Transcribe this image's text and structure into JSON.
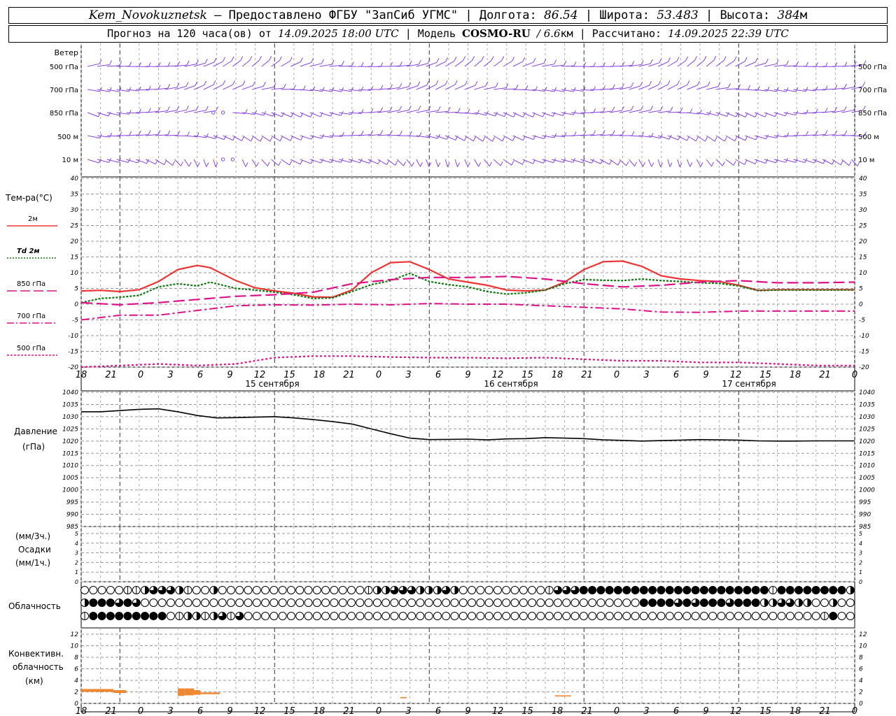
{
  "header": {
    "station": "Kem_Novokuznetsk",
    "provider": "— Предоставлено ФГБУ \"ЗапСиб УГМС\"",
    "lon_label": "| Долгота:",
    "lon": "86.54",
    "lat_label": "| Широта:",
    "lat": "53.483",
    "alt_label": "| Высота:",
    "alt": "384",
    "alt_unit": "м",
    "forecast_label": "Прогноз на 120 часа(ов) от",
    "forecast_start": "14.09.2025 18:00 UTC",
    "model_label": "| Модель",
    "model": "COSMO-RU",
    "resolution": "/ 6.6",
    "resolution_unit": "км",
    "calc_label": "| Рассчитано:",
    "calc_time": "14.09.2025 22:39 UTC"
  },
  "panels": {
    "wind": {
      "title": "Ветер",
      "levels": [
        "500 гПа",
        "700 гПа",
        "850 гПа",
        "500 м",
        "10 м"
      ]
    },
    "temperature": {
      "title": "Тем-ра(°C)",
      "legend": [
        {
          "label": "2м",
          "color": "#ee3333",
          "dash": "solid"
        },
        {
          "label": "Td 2м",
          "color": "#117711",
          "dash": "dotted"
        },
        {
          "label": "850 гПа",
          "color": "#dd1188",
          "dash": "long"
        },
        {
          "label": "700 гПа",
          "color": "#dd1188",
          "dash": "dashdot"
        },
        {
          "label": "500 гПа",
          "color": "#dd1188",
          "dash": "short"
        }
      ]
    },
    "pressure": {
      "title": "Давление",
      "unit": "(гПа)"
    },
    "precip": {
      "unit_top": "(мм/3ч.)",
      "title": "Осадки",
      "unit_bottom": "(мм/1ч.)"
    },
    "cloud": {
      "title": "Облачность"
    },
    "convective": {
      "title_1": "Конвективн.",
      "title_2": "облачность",
      "unit": "(км)"
    }
  },
  "time_axis": {
    "hour_labels": [
      "18",
      "21",
      "0",
      "3",
      "6",
      "9",
      "12",
      "15",
      "18",
      "21",
      "0",
      "3",
      "6",
      "9",
      "12",
      "15",
      "18",
      "21",
      "0",
      "3",
      "6",
      "9",
      "12",
      "15",
      "18",
      "21",
      "0"
    ],
    "day_labels": [
      "15 сентября",
      "16 сентября",
      "17 сентября"
    ],
    "day_label_positions_h": [
      15,
      39,
      63
    ]
  },
  "colors": {
    "temp2m": "#ee3333",
    "dew": "#117711",
    "upper": "#dd1188",
    "wind": "#8844dd",
    "pressure": "#000000",
    "convective": "#ee8833"
  },
  "chart_data": [
    {
      "type": "line",
      "title": "Тем-ра(°C)",
      "x_unit": "hours since 14.09.2025 18:00 UTC",
      "ylim": [
        -20,
        40
      ],
      "y_ticks": [
        -20,
        -15,
        -10,
        -5,
        0,
        5,
        10,
        15,
        20,
        25,
        30,
        35,
        40
      ],
      "series": [
        {
          "name": "2м",
          "x": [
            0,
            3,
            6,
            9,
            12,
            15,
            18,
            20,
            24,
            27,
            30,
            33,
            36,
            39,
            42,
            45,
            48,
            51,
            54,
            57,
            60,
            63,
            66,
            69,
            72,
            75,
            78,
            81,
            84,
            87,
            90,
            93,
            96,
            99,
            102,
            105,
            108,
            111,
            114,
            117,
            120
          ],
          "y": [
            4.2,
            4.4,
            4.0,
            4.6,
            7.2,
            11,
            12.3,
            11.6,
            7.5,
            5.2,
            4.2,
            3.5,
            2.3,
            2.2,
            4.5,
            10,
            13.2,
            13.5,
            11,
            8,
            7,
            6,
            4.5,
            4.2,
            4.5,
            7,
            11,
            13.5,
            13.7,
            12,
            9,
            8,
            7.5,
            7.2,
            6,
            4.4,
            4.6,
            4.6,
            4.6,
            4.6,
            4.6
          ]
        },
        {
          "name": "Td 2м",
          "x": [
            0,
            3,
            6,
            9,
            12,
            15,
            18,
            20,
            24,
            27,
            30,
            33,
            36,
            39,
            42,
            45,
            48,
            51,
            54,
            57,
            60,
            63,
            66,
            69,
            72,
            75,
            78,
            81,
            84,
            87,
            90,
            93,
            96,
            99,
            102,
            105,
            108,
            111,
            114,
            117,
            120
          ],
          "y": [
            0.5,
            1.8,
            2.2,
            2.8,
            5.5,
            6.5,
            5.8,
            7.0,
            5,
            4.5,
            3.8,
            3,
            1.8,
            2,
            4,
            6.2,
            7.5,
            9.8,
            7.2,
            6.2,
            5.5,
            4,
            3.2,
            3.6,
            4.5,
            6.5,
            7.8,
            7.6,
            7.5,
            8,
            7.5,
            7.2,
            6.8,
            6.6,
            5.8,
            4.3,
            4.5,
            4.5,
            4.5,
            4.5,
            4.5
          ]
        },
        {
          "name": "850 гПа",
          "x": [
            0,
            6,
            12,
            18,
            24,
            30,
            36,
            42,
            48,
            54,
            60,
            66,
            72,
            78,
            84,
            90,
            96,
            102,
            108,
            114,
            120
          ],
          "y": [
            0.5,
            -0.2,
            0.5,
            1.5,
            2.5,
            3,
            3.8,
            6.5,
            7.8,
            8.5,
            8.5,
            8.8,
            8,
            6.5,
            5.5,
            6,
            7,
            7.5,
            6.8,
            6.8,
            7
          ]
        },
        {
          "name": "700 гПа",
          "x": [
            0,
            6,
            12,
            18,
            24,
            30,
            36,
            42,
            48,
            54,
            60,
            66,
            72,
            78,
            84,
            90,
            96,
            102,
            108,
            114,
            120
          ],
          "y": [
            -5,
            -3.5,
            -3.5,
            -2,
            -0.5,
            -0.2,
            -0.3,
            0,
            -0.2,
            0.2,
            0,
            0,
            -0.5,
            -1,
            -1.5,
            -2.5,
            -2.6,
            -2.2,
            -2.2,
            -2.2,
            -2.2
          ]
        },
        {
          "name": "500 гПа",
          "x": [
            0,
            6,
            12,
            18,
            24,
            30,
            36,
            42,
            48,
            54,
            60,
            66,
            72,
            78,
            84,
            90,
            96,
            102,
            108,
            114,
            120
          ],
          "y": [
            -20,
            -19.5,
            -19,
            -19.5,
            -19,
            -17,
            -16.5,
            -16.5,
            -16.8,
            -17,
            -17,
            -17.2,
            -17,
            -17.5,
            -18,
            -18,
            -18.5,
            -18.5,
            -19,
            -19.5,
            -19.5
          ]
        }
      ]
    },
    {
      "type": "line",
      "title": "Давление",
      "ylabel": "(гПа)",
      "ylim": [
        985,
        1040
      ],
      "y_ticks": [
        985,
        990,
        995,
        1000,
        1005,
        1010,
        1015,
        1020,
        1025,
        1030,
        1035,
        1040
      ],
      "series": [
        {
          "x": [
            0,
            3,
            6,
            9,
            12,
            15,
            18,
            21,
            24,
            27,
            30,
            33,
            36,
            39,
            42,
            45,
            48,
            51,
            54,
            57,
            60,
            63,
            66,
            69,
            72,
            75,
            78,
            81,
            84,
            87,
            90,
            93,
            96,
            99,
            102,
            105,
            108,
            111,
            114,
            117,
            120
          ],
          "y": [
            1032,
            1032,
            1032.5,
            1033,
            1033.2,
            1032,
            1030.5,
            1029.5,
            1029.6,
            1029.8,
            1030,
            1029.5,
            1028.8,
            1028,
            1027,
            1025,
            1023,
            1021.2,
            1020.6,
            1020.7,
            1020.8,
            1020.5,
            1020.9,
            1021,
            1021.4,
            1021.2,
            1021,
            1020.5,
            1020.3,
            1020,
            1020.2,
            1020.4,
            1020.6,
            1020.5,
            1020.4,
            1020.1,
            1020,
            1020,
            1020.1,
            1020.1,
            1020.1
          ]
        }
      ]
    },
    {
      "type": "bar",
      "title": "Осадки",
      "ylabel": "(мм/1ч.)",
      "ylim": [
        0,
        5
      ],
      "y_ticks": [
        0,
        1,
        2,
        3,
        4,
        5
      ],
      "values": []
    },
    {
      "type": "bar",
      "title": "Конвективн. облачность",
      "ylabel": "(км)",
      "ylim": [
        0,
        13
      ],
      "y_ticks": [
        0,
        2,
        4,
        6,
        8,
        10,
        12
      ],
      "segments": [
        {
          "x0": 0,
          "x1": 5,
          "bottom": 2.0,
          "top": 2.5
        },
        {
          "x0": 5,
          "x1": 7,
          "bottom": 1.8,
          "top": 2.3
        },
        {
          "x0": 12,
          "x1": 14,
          "bottom": 0,
          "top": 0
        },
        {
          "x0": 15,
          "x1": 16,
          "bottom": 1.3,
          "top": 2.6
        },
        {
          "x0": 16,
          "x1": 17.5,
          "bottom": 1.4,
          "top": 2.6
        },
        {
          "x0": 17.5,
          "x1": 18.5,
          "bottom": 1.5,
          "top": 2.3
        },
        {
          "x0": 18.5,
          "x1": 21.5,
          "bottom": 1.6,
          "top": 1.9
        },
        {
          "x0": 49.5,
          "x1": 50.5,
          "bottom": 0.9,
          "top": 1.1
        },
        {
          "x0": 73.5,
          "x1": 76,
          "bottom": 1.2,
          "top": 1.4
        }
      ]
    }
  ],
  "cloud_rows": [
    "0000011233321002000000000000000001223332223200000000001333444444444444444444444414444444420",
    "2444343000000000000000000000000000000000000000000000000000000000044443434443444223322002",
    "1444444444012212313000000000000000000000000000000000000000000000000000000000000000000014"
  ]
}
